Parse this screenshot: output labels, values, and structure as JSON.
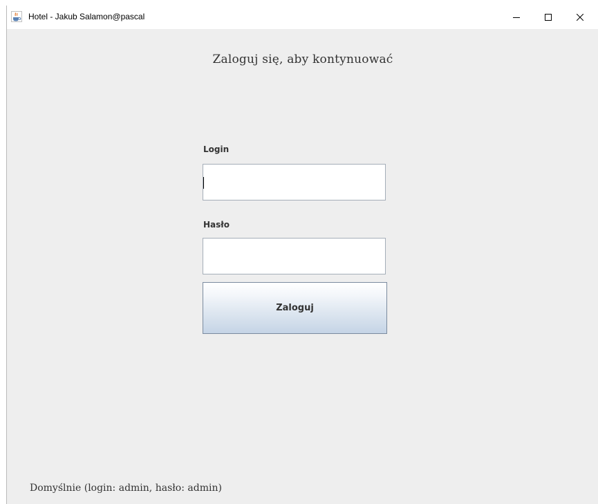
{
  "window": {
    "title": "Hotel - Jakub Salamon@pascal",
    "app_icon": "java-coffee-cup-icon",
    "controls": {
      "minimize": "minimize-icon",
      "maximize": "maximize-icon",
      "close": "close-icon"
    }
  },
  "login_form": {
    "heading": "Zaloguj się, aby kontynuować",
    "login_label": "Login",
    "login_value": "",
    "password_label": "Hasło",
    "password_value": "",
    "submit_label": "Zaloguj"
  },
  "footer": {
    "hint": "Domyślnie (login: admin, hasło: admin)"
  },
  "colors": {
    "window_background": "#eeeeee",
    "button_gradient_bottom": "#c5d4e6",
    "field_border": "#a4adb8"
  }
}
